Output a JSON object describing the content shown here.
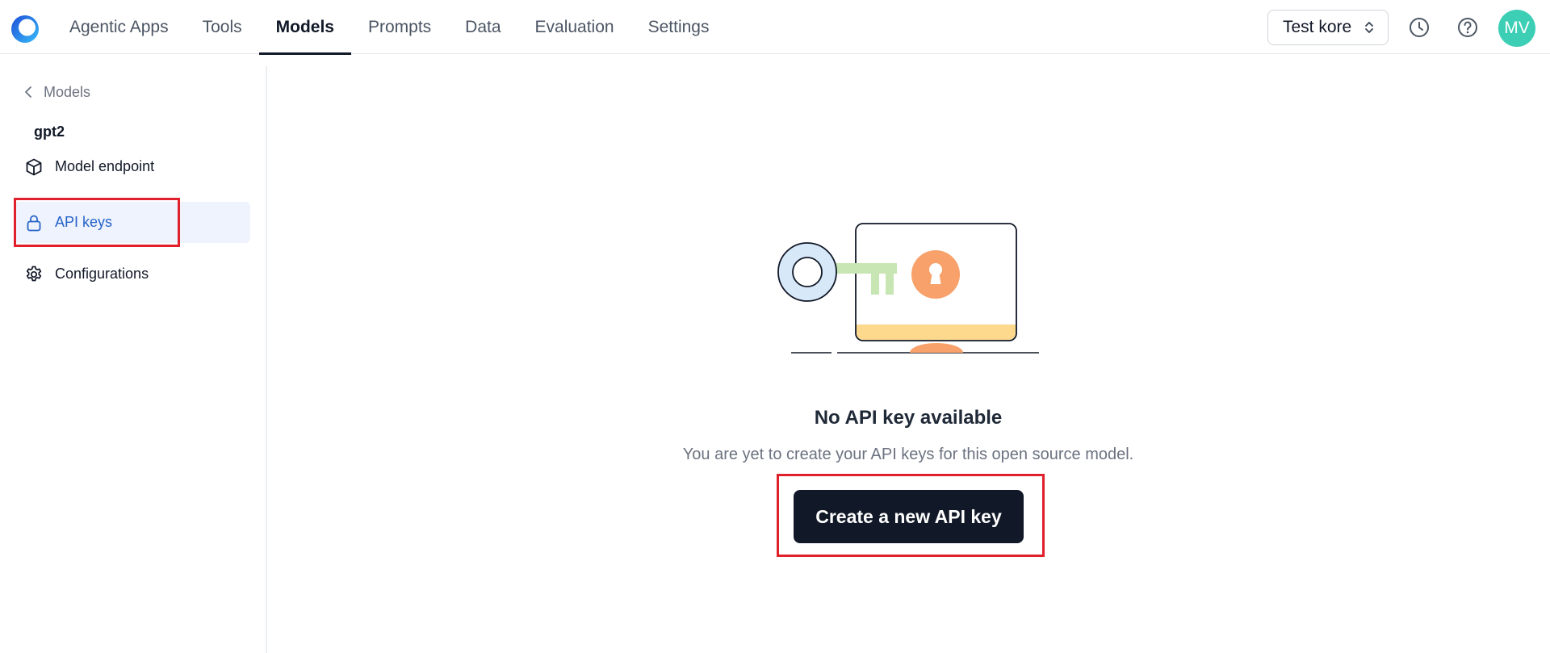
{
  "nav": {
    "tabs": [
      {
        "label": "Agentic Apps"
      },
      {
        "label": "Tools"
      },
      {
        "label": "Models"
      },
      {
        "label": "Prompts"
      },
      {
        "label": "Data"
      },
      {
        "label": "Evaluation"
      },
      {
        "label": "Settings"
      }
    ],
    "active_tab": "Models"
  },
  "header": {
    "workspace": "Test kore",
    "history_icon": "clock-icon",
    "help_icon": "help-circle-icon",
    "avatar_initials": "MV",
    "avatar_color": "#3ccfb6"
  },
  "sidebar": {
    "back_label": "Models",
    "model_name": "gpt2",
    "items": [
      {
        "label": "Model endpoint",
        "icon": "cube-icon"
      },
      {
        "label": "API keys",
        "icon": "lock-icon"
      },
      {
        "label": "Configurations",
        "icon": "gear-icon"
      }
    ],
    "active_item": "API keys"
  },
  "empty_state": {
    "illustration_icon": "key-lock-monitor-illustration",
    "title": "No API key available",
    "description": "You are yet to create your API keys for this open source model.",
    "button_label": "Create a new API key"
  },
  "colors": {
    "highlight": "#e0202b",
    "accent_blue": "#2563c9",
    "primary_button": "#111827"
  }
}
